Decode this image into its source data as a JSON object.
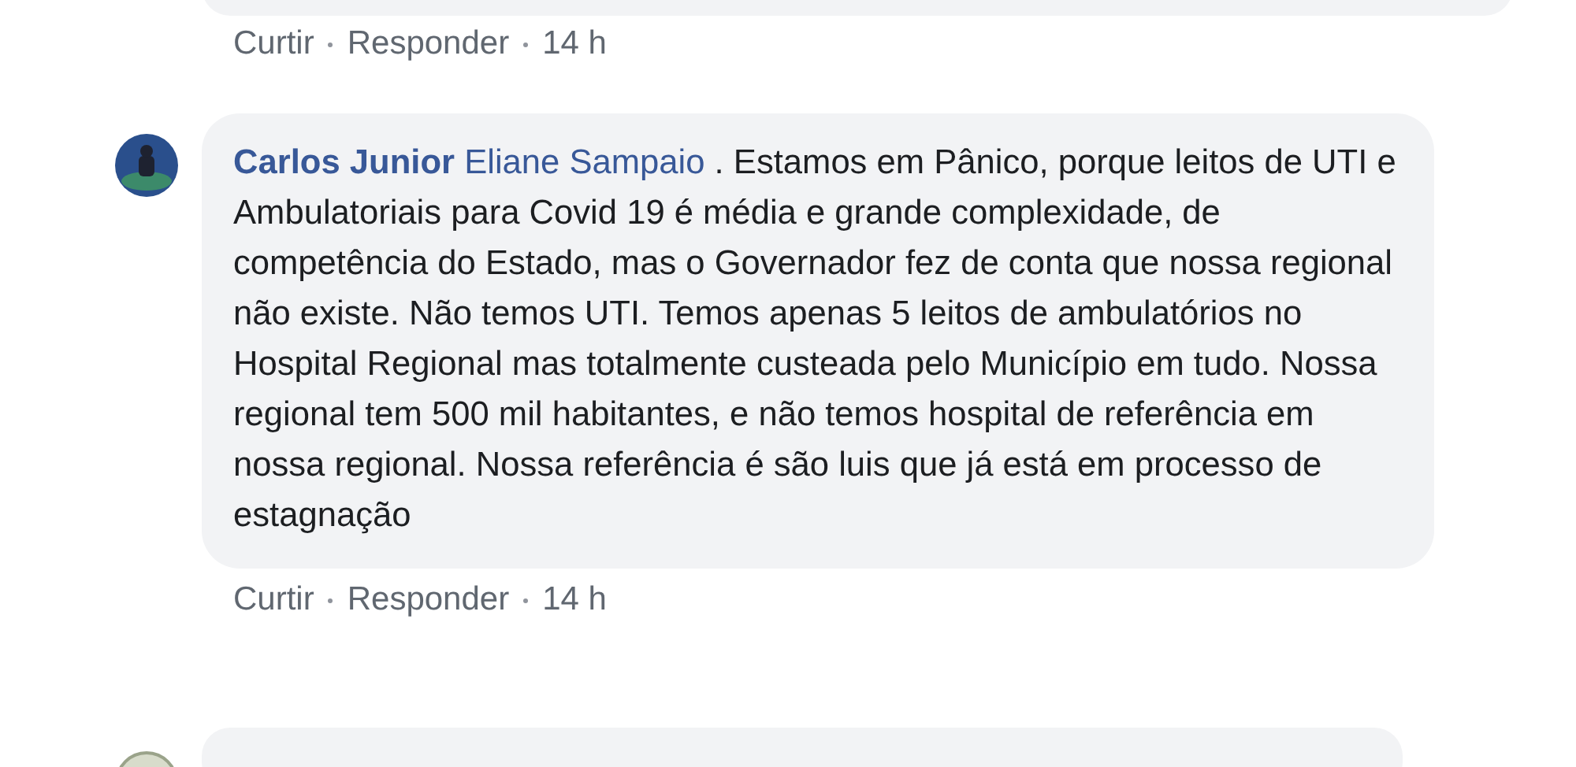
{
  "comments": [
    {
      "kind": "cut_top",
      "actions": [
        "Curtir",
        "Responder"
      ],
      "time": "14 h"
    },
    {
      "kind": "full",
      "author": "Carlos Junior",
      "mention": "Eliane Sampaio",
      "text": " . Estamos em Pânico, porque leitos de UTI e Ambulatoriais para Covid 19 é média e grande complexidade, de competência do Estado, mas o Governador fez de conta que nossa regional não existe. Não temos UTI. Temos apenas 5 leitos de ambulatórios no Hospital Regional mas totalmente custeada pelo Município em tudo. Nossa regional tem 500 mil habitantes, e não temos hospital de referência em nossa regional. Nossa referência é são luis que já está em processo de estagnação",
      "actions": [
        "Curtir",
        "Responder"
      ],
      "time": "14 h"
    },
    {
      "kind": "cut_bottom"
    }
  ]
}
